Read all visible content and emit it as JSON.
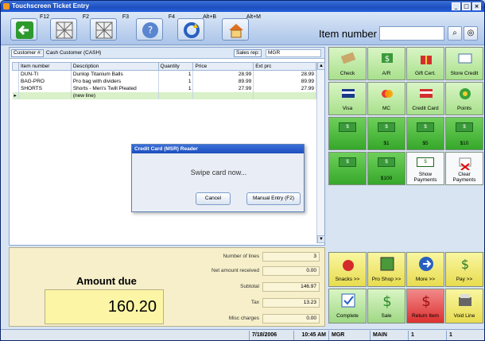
{
  "window": {
    "title": "Touchscreen Ticket Entry",
    "controls": [
      "_",
      "□",
      "×"
    ]
  },
  "toolbar": {
    "buttons": [
      {
        "key": "F12",
        "icon": "arrow-left-icon"
      },
      {
        "key": "F2",
        "icon": "grid-icon"
      },
      {
        "key": "F3",
        "icon": "grid-icon"
      },
      {
        "key": "F4",
        "icon": "help-icon"
      },
      {
        "key": "Alt+B",
        "icon": "refresh-icon"
      },
      {
        "key": "Alt+M",
        "icon": "home-icon"
      }
    ],
    "item_label": "Item number",
    "item_value": ""
  },
  "customer": {
    "label": "Customer #:",
    "value": "Cash Customer  (CASH)",
    "sales_rep_label": "Sales rep:",
    "sales_rep": "MGR"
  },
  "grid": {
    "columns": [
      "Item number",
      "Description",
      "Quantity",
      "Price",
      "Ext prc"
    ],
    "rows": [
      {
        "item": "DUN-TI",
        "desc": "Dunlop Titanium Balls",
        "qty": "1",
        "price": "28.99",
        "ext": "28.99"
      },
      {
        "item": "BAG-PRO",
        "desc": "Pro bag with dividers",
        "qty": "1",
        "price": "89.99",
        "ext": "89.99"
      },
      {
        "item": "SHORTS",
        "desc": "Shorts - Men's Twill Pleated",
        "qty": "1",
        "price": "27.99",
        "ext": "27.99"
      }
    ],
    "new_line": "(new line)"
  },
  "totals": {
    "amount_due_label": "Amount due",
    "amount_due": "160.20",
    "lines": [
      {
        "label": "Number of lines",
        "value": "3"
      },
      {
        "label": "Net amount received",
        "value": "0.00"
      },
      {
        "label": "Subtotal",
        "value": "146.97"
      },
      {
        "label": "Tax",
        "value": "13.23"
      },
      {
        "label": "Misc charges",
        "value": "0.00"
      }
    ]
  },
  "payments": {
    "row1": [
      "Check",
      "A/R",
      "Gift Cert.",
      "Store Credit"
    ],
    "row2": [
      "Visa",
      "MC",
      "Credit Card",
      "Points"
    ],
    "row3": [
      "$1",
      "$5",
      "$10"
    ],
    "row4": [
      "$100",
      "Show Payments",
      "Clear Payments"
    ],
    "cash_glyph": "$"
  },
  "functions": [
    "Snacks >>",
    "Pro Shop >>",
    "More >>",
    "Pay >>",
    "Complete",
    "Sale",
    "Return Item",
    "Void Line"
  ],
  "status": {
    "date": "7/18/2006",
    "time": "10:45 AM",
    "user": "MGR",
    "store": "MAIN",
    "f1": "1",
    "f2": "1"
  },
  "dialog": {
    "title": "Credit Card (MSR) Reader",
    "message": "Swipe card now...",
    "cancel": "Cancel",
    "manual": "Manual Entry (F2)"
  }
}
